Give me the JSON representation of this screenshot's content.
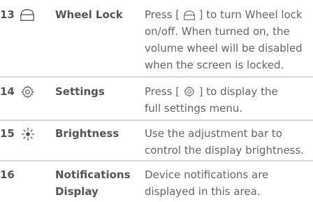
{
  "rows": [
    {
      "number": "13",
      "icon": "lock-icon",
      "name_lines": [
        "Wheel Lock"
      ],
      "desc_pre": "Press [",
      "desc_inline_icon": "lock-icon",
      "desc_post": "] to turn Wheel lock",
      "desc_lines": [
        "on/off. When turned on, the",
        "volume wheel will be disabled",
        "when the screen is locked."
      ]
    },
    {
      "number": "14",
      "icon": "gear-icon",
      "name_lines": [
        "Settings"
      ],
      "desc_pre": "Press [",
      "desc_inline_icon": "gear-icon",
      "desc_post": "] to display the",
      "desc_lines": [
        "full settings menu."
      ]
    },
    {
      "number": "15",
      "icon": "sun-icon",
      "name_lines": [
        "Brightness"
      ],
      "desc_lines_full": [
        "Use the adjustment bar to",
        "control the display brightness."
      ]
    },
    {
      "number": "16",
      "name_lines": [
        "Notifications",
        "Display"
      ],
      "desc_lines_full": [
        "Device notifications are",
        "displayed in this area."
      ]
    }
  ],
  "colors": {
    "divider": "#d8d8d8",
    "text": "#666666"
  }
}
